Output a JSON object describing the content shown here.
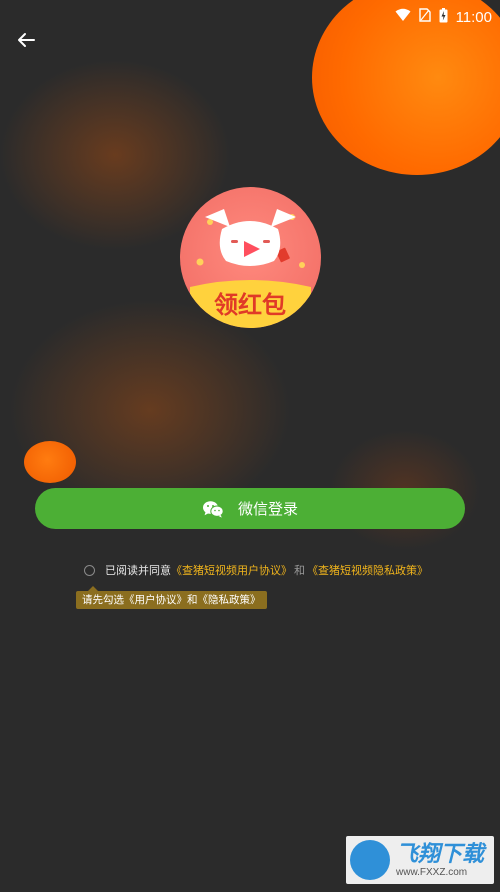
{
  "status_bar": {
    "time": "11:00",
    "icons": [
      "wifi-icon",
      "sim-card-icon",
      "battery-charging-icon"
    ]
  },
  "header": {
    "back_icon": "arrow-left-icon"
  },
  "logo": {
    "text": "领红包",
    "icon": "pig-play-icon"
  },
  "login": {
    "button_label": "微信登录",
    "icon": "wechat-icon",
    "color": "#4caf35"
  },
  "agreement": {
    "prefix": "已阅读并同意",
    "user_agreement_link": "《查猪短视频用户协议》",
    "connector": "和",
    "privacy_link": "《查猪短视频隐私政策》",
    "checked": false,
    "link_color": "#f0b41c"
  },
  "tooltip": {
    "text": "请先勾选《用户协议》和《隐私政策》"
  },
  "watermark": {
    "brand": "飞翔下载",
    "url": "www.FXXZ.com"
  }
}
